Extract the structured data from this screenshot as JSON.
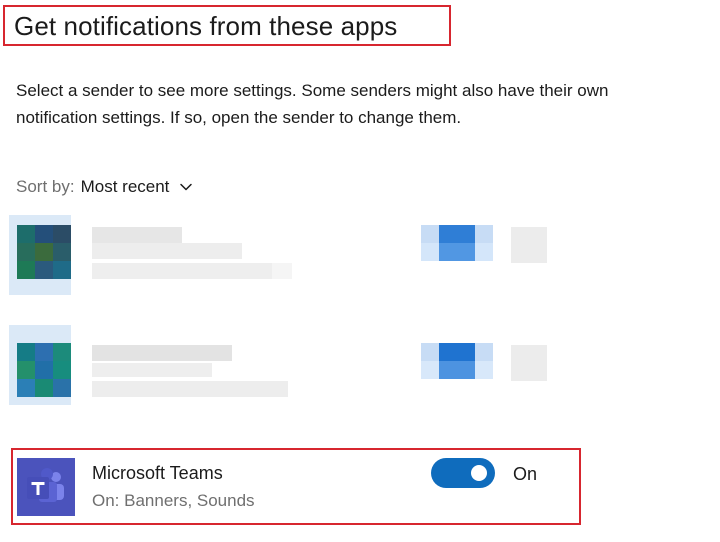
{
  "header": {
    "title": "Get notifications from these apps"
  },
  "description": "Select a sender to see more settings. Some senders might also have their own notification settings. If so, open the sender to change them.",
  "sort": {
    "label": "Sort by:",
    "value": "Most recent"
  },
  "apps": [
    {
      "name": "",
      "detail": "",
      "redacted": true
    },
    {
      "name": "",
      "detail": "",
      "redacted": true
    },
    {
      "name": "Microsoft Teams",
      "detail": "On: Banners, Sounds",
      "toggle_state": "On",
      "icon": "teams-icon"
    }
  ],
  "colors": {
    "highlight_border": "#d7262f",
    "toggle_on": "#0f6cbd",
    "teams_brand": "#4b53bc"
  }
}
